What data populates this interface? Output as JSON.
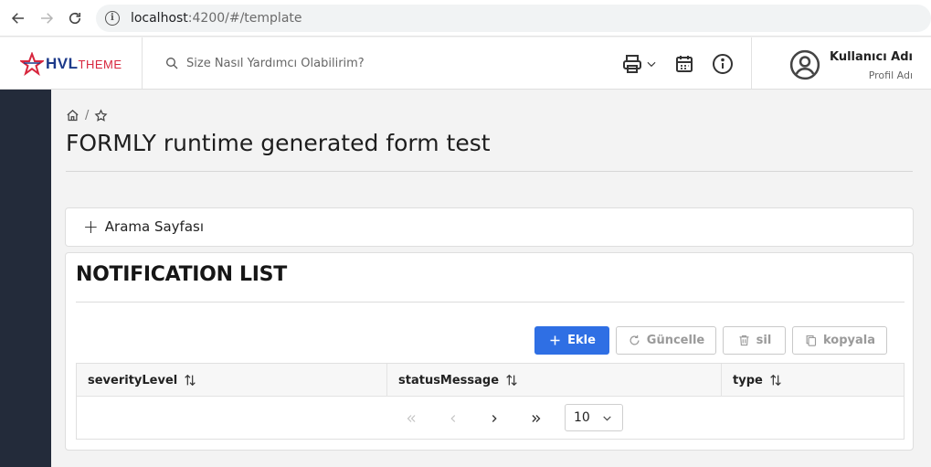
{
  "browser": {
    "url_host": "localhost",
    "url_path": ":4200/#/template"
  },
  "header": {
    "logo": {
      "brand_main": "HVL",
      "brand_accent": "THEME"
    },
    "search_placeholder": "Size Nasıl Yardımcı Olabilirim?",
    "user": {
      "name": "Kullanıcı Adı",
      "profile": "Profil Adı"
    },
    "icons": [
      "printer-icon",
      "calendar-icon",
      "info-icon",
      "user-avatar-icon"
    ]
  },
  "breadcrumb": {
    "icons": [
      "home-icon",
      "star-icon"
    ],
    "separator": "/"
  },
  "page": {
    "title": "FORMLY runtime generated form test"
  },
  "search_panel": {
    "toggle_label": "Arama Sayfası"
  },
  "list": {
    "title": "NOTIFICATION LIST",
    "buttons": {
      "add": "Ekle",
      "update": "Güncelle",
      "delete": "sil",
      "copy": "kopyala"
    },
    "columns": [
      "severityLevel",
      "statusMessage",
      "type"
    ],
    "rows": [],
    "paginator": {
      "rows_per_page": "10"
    }
  },
  "colors": {
    "primary": "#2f6fe4",
    "sidebar": "#232b3a",
    "brand_red": "#d7263d",
    "brand_blue": "#1d3a8a"
  }
}
